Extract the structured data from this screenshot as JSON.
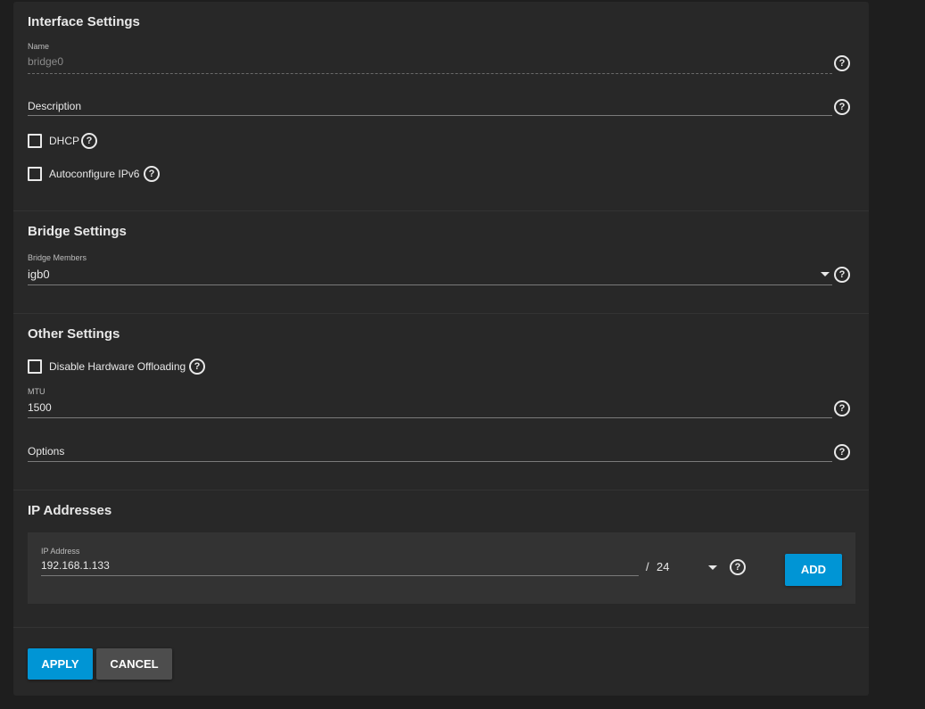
{
  "interface_settings": {
    "title": "Interface Settings",
    "name_label": "Name",
    "name_value": "bridge0",
    "description_placeholder": "Description",
    "dhcp_label": "DHCP",
    "ipv6_label": "Autoconfigure IPv6"
  },
  "bridge_settings": {
    "title": "Bridge Settings",
    "members_label": "Bridge Members",
    "members_value": "igb0"
  },
  "other_settings": {
    "title": "Other Settings",
    "offload_label": "Disable Hardware Offloading",
    "mtu_label": "MTU",
    "mtu_value": "1500",
    "options_placeholder": "Options"
  },
  "ip_addresses": {
    "title": "IP Addresses",
    "ip_label": "IP Address",
    "ip_value": "192.168.1.133",
    "slash": "/",
    "netmask": "24",
    "add_label": "ADD"
  },
  "actions": {
    "apply_label": "APPLY",
    "cancel_label": "CANCEL"
  },
  "help_glyph": "?",
  "colors": {
    "primary": "#0095d5",
    "panel": "#282828",
    "background": "#1e1e1e"
  }
}
